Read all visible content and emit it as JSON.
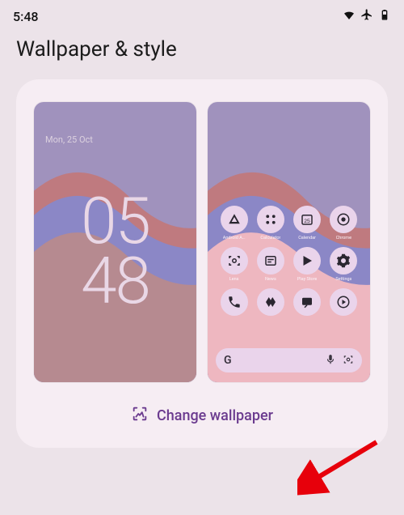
{
  "status": {
    "time": "5:48"
  },
  "title": "Wallpaper & style",
  "lock": {
    "date": "Mon, 25 Oct",
    "time_top": "05",
    "time_bottom": "48"
  },
  "home": {
    "apps": [
      {
        "name": "android-auto",
        "label": "Android A…"
      },
      {
        "name": "calculator",
        "label": "Calculator"
      },
      {
        "name": "calendar",
        "label": "Calendar",
        "day": "25"
      },
      {
        "name": "chrome",
        "label": "Chrome"
      },
      {
        "name": "lens",
        "label": "Lens"
      },
      {
        "name": "news",
        "label": "News"
      },
      {
        "name": "play-store",
        "label": "Play Store"
      },
      {
        "name": "settings",
        "label": "Settings"
      },
      {
        "name": "phone",
        "label": ""
      },
      {
        "name": "wear",
        "label": ""
      },
      {
        "name": "messages",
        "label": ""
      },
      {
        "name": "youtube",
        "label": ""
      }
    ],
    "search_letter": "G"
  },
  "button": {
    "label": "Change wallpaper"
  }
}
